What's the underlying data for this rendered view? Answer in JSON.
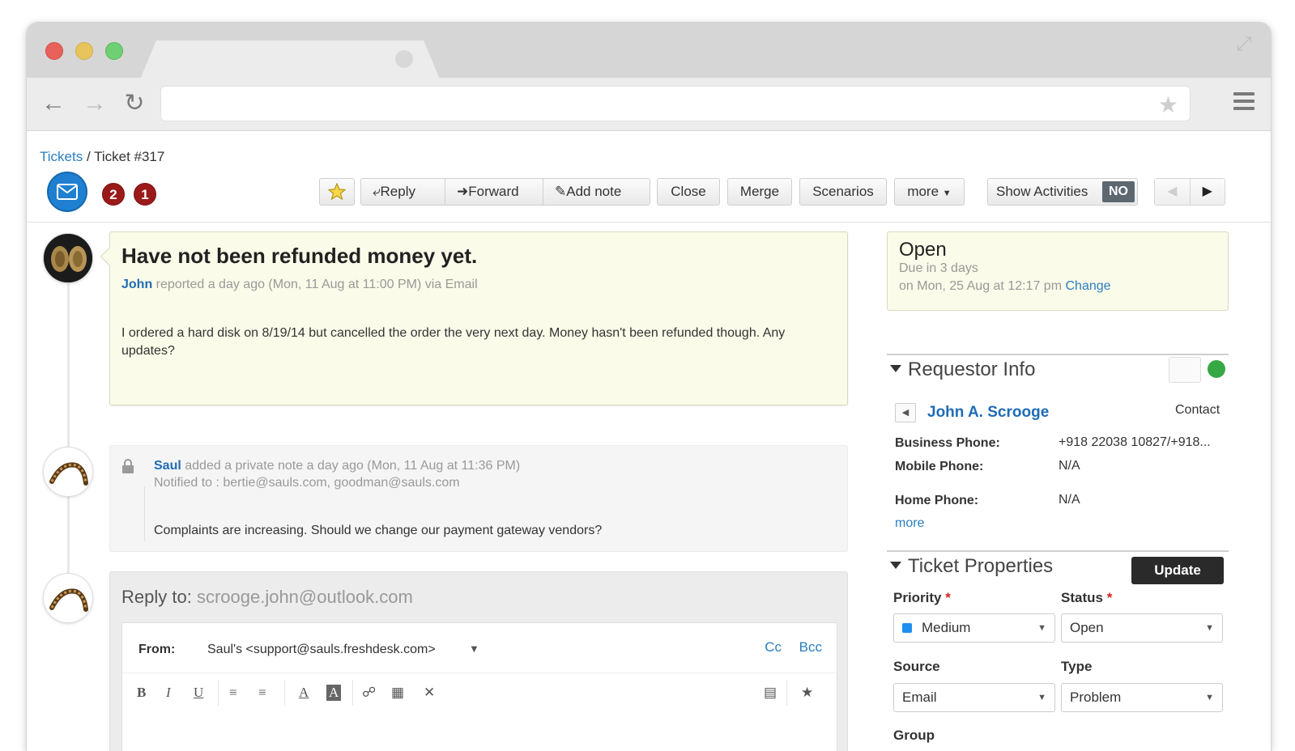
{
  "breadcrumb": {
    "root": "Tickets",
    "separator": " / ",
    "current": "Ticket #317"
  },
  "badges": {
    "count_2": "2",
    "count_1": "1"
  },
  "toolbar": {
    "reply": "Reply",
    "forward": "Forward",
    "add_note": "Add note",
    "close": "Close",
    "merge": "Merge",
    "scenarios": "Scenarios",
    "more": "more",
    "show_activities": "Show Activities",
    "show_activities_toggle": "NO"
  },
  "ticket": {
    "title": "Have not been refunded money yet.",
    "author": "John",
    "meta": " reported a day ago (Mon, 11 Aug at 11:00 PM) via Email",
    "body": "I ordered a hard disk on 8/19/14 but cancelled the order the very next day. Money hasn't been refunded though. Any updates?"
  },
  "note": {
    "author": "Saul",
    "meta": " added a private note a day ago (Mon, 11 Aug at 11:36 PM)",
    "notified": "Notified to : bertie@sauls.com, goodman@sauls.com",
    "body": "Complaints are increasing. Should we change our payment gateway vendors?"
  },
  "reply": {
    "label": "Reply to: ",
    "address": "scrooge.john@outlook.com",
    "from_label": "From:",
    "from_value": "Saul's <support@sauls.freshdesk.com>",
    "cc": "Cc",
    "bcc": "Bcc"
  },
  "status": {
    "state": "Open",
    "due": "Due in 3 days",
    "due_on": "on Mon, 25 Aug at 12:17 pm ",
    "change": "Change"
  },
  "requestor": {
    "section_title": "Requestor Info",
    "name": "John A. Scrooge",
    "type": "Contact",
    "business_phone_label": "Business Phone:",
    "business_phone": "+918 22038 10827/+918...",
    "mobile_phone_label": "Mobile Phone:",
    "mobile_phone": "N/A",
    "home_phone_label": "Home Phone:",
    "home_phone": "N/A",
    "more": "more"
  },
  "properties": {
    "section_title": "Ticket Properties",
    "update": "Update",
    "priority_label": "Priority",
    "priority": "Medium",
    "status_label": "Status",
    "status": "Open",
    "source_label": "Source",
    "source": "Email",
    "type_label": "Type",
    "type": "Problem",
    "group_label": "Group",
    "required_mark": "*"
  },
  "colors": {
    "accent": "#2a7ec2",
    "ticket_bg": "#fbfbe9",
    "badge": "#9a1a1a",
    "priority_medium": "#1f8fef"
  }
}
